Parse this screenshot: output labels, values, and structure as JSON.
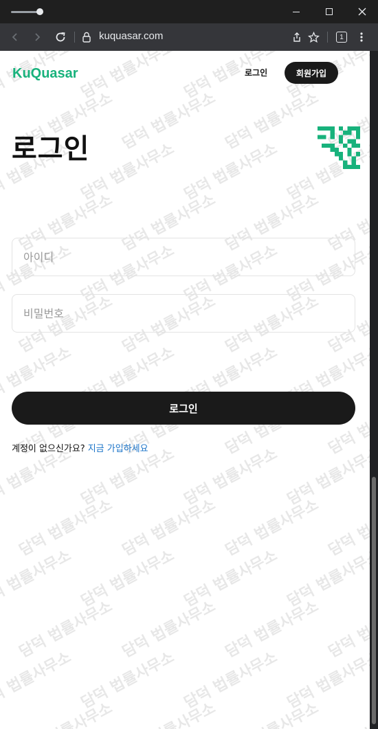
{
  "browser": {
    "url": "kuquasar.com",
    "tab_count": "1"
  },
  "header": {
    "brand": "KuQuasar",
    "login_link": "로그인",
    "signup_button": "회원가입"
  },
  "main": {
    "title": "로그인",
    "username_placeholder": "아이디",
    "password_placeholder": "비밀번호",
    "submit_label": "로그인",
    "no_account_text": "계정이 없으신가요?",
    "signup_link": "지금 가입하세요"
  },
  "watermark": {
    "text": "담덕 법률사무소"
  },
  "colors": {
    "brand": "#18b27c",
    "dark_button": "#1a1a1a",
    "link": "#1a73c8"
  }
}
